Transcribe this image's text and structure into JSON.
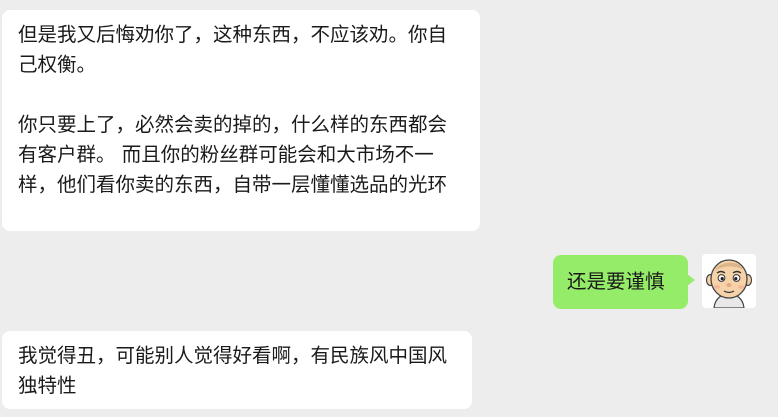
{
  "chat": {
    "messages": [
      {
        "side": "left",
        "text": "但是我又后悔劝你了，这种东西，不应该劝。你自己权衡。\n\n你只要上了，必然会卖的掉的，什么样的东西都会有客户群。 而且你的粉丝群可能会和大市场不一样，他们看你卖的东西，自带一层懂懂选品的光环"
      },
      {
        "side": "right",
        "text": "还是要谨慎"
      },
      {
        "side": "left",
        "text": "我觉得丑，可能别人觉得好看啊，有民族风中国风独特性"
      }
    ]
  },
  "colors": {
    "background": "#ededed",
    "incoming_bubble": "#ffffff",
    "outgoing_bubble": "#95ec69"
  },
  "icons": {
    "sender_avatar": "cartoon-bald-boy-avatar"
  }
}
